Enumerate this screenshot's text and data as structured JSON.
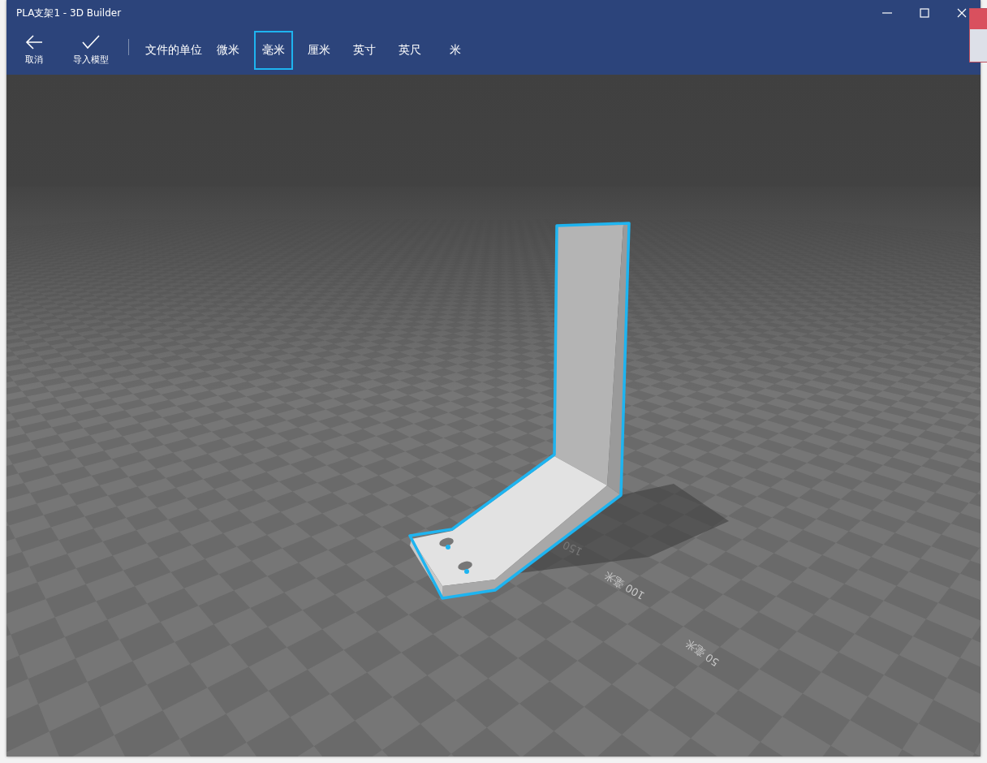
{
  "window": {
    "title": "PLA支架1 - 3D Builder"
  },
  "toolbar": {
    "buttons": [
      {
        "kind": "back",
        "label": "取消"
      },
      {
        "kind": "check",
        "label": "导入模型"
      }
    ],
    "units_label": "文件的单位",
    "units": [
      {
        "label": "微米",
        "selected": false
      },
      {
        "label": "毫米",
        "selected": true
      },
      {
        "label": "厘米",
        "selected": false
      },
      {
        "label": "英寸",
        "selected": false
      },
      {
        "label": "英尺",
        "selected": false
      },
      {
        "label": "米",
        "selected": false
      }
    ]
  },
  "viewport": {
    "ruler_labels": [
      {
        "text": "150"
      },
      {
        "text": "100 毫米"
      },
      {
        "text": "50 毫米"
      }
    ]
  }
}
